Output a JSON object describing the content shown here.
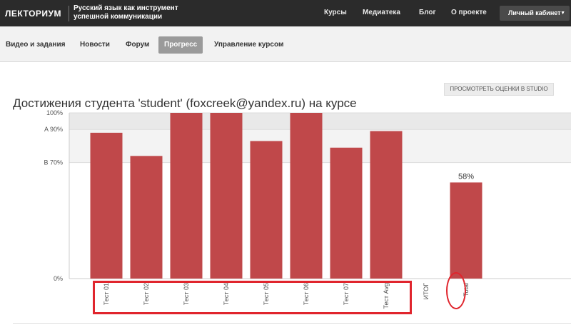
{
  "header": {
    "logo": "ЛЕКТОРИУМ",
    "course_title": "Русский язык как инструмент успешной коммуникации",
    "nav": [
      {
        "label": "Курсы",
        "name": "nav-courses"
      },
      {
        "label": "Медиатека",
        "name": "nav-mediateka"
      },
      {
        "label": "Блог",
        "name": "nav-blog"
      },
      {
        "label": "О проекте",
        "name": "nav-about"
      }
    ],
    "cabinet_label": "Личный кабинет"
  },
  "tabs": [
    {
      "label": "Видео и задания",
      "active": false
    },
    {
      "label": "Новости",
      "active": false
    },
    {
      "label": "Форум",
      "active": false
    },
    {
      "label": "Прогресс",
      "active": true
    },
    {
      "label": "Управление курсом",
      "active": false
    }
  ],
  "studio_button": "ПРОСМОТРЕТЬ ОЦЕНКИ В STUDIO",
  "student_title": "Достижения студента 'student' (foxcreek@yandex.ru) на курсе",
  "colors": {
    "bar": "#c0484a",
    "band": "#eeeeee",
    "annotation": "#e0252d"
  },
  "chart_data": {
    "type": "bar",
    "categories": [
      "Тест 01",
      "Тест 02",
      "Тест 03",
      "Тест 04",
      "Тест 05",
      "Тест 06",
      "Тест 07",
      "Тест Avg",
      "ИТОГ",
      "Total"
    ],
    "values": [
      88,
      74,
      100,
      100,
      83,
      100,
      79,
      89,
      null,
      58
    ],
    "data_labels": {
      "Total": "58%"
    },
    "yticks": [
      {
        "label": "100%",
        "value": 100
      },
      {
        "label": "A 90%",
        "value": 90
      },
      {
        "label": "B 70%",
        "value": 70
      },
      {
        "label": "0%",
        "value": 0
      }
    ],
    "ylim": [
      0,
      100
    ],
    "grade_bands": [
      {
        "from": 90,
        "to": 100
      },
      {
        "from": 70,
        "to": 90
      }
    ],
    "grid": false
  }
}
